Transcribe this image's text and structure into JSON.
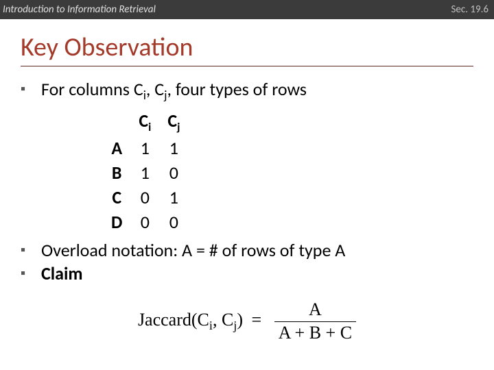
{
  "header": {
    "left": "Introduction to Information Retrieval",
    "right": "Sec. 19.6"
  },
  "title": "Key Observation",
  "bullets": {
    "b1_prefix": "For columns C",
    "b1_mid1": ", C",
    "b1_suffix": ", four types of rows",
    "b2": "Overload notation: A = # of rows of type A",
    "b3_label": "Claim"
  },
  "table": {
    "col_label_base": "C",
    "col_sub_1": "i",
    "col_sub_2": "j",
    "rows": [
      {
        "label": "A",
        "v1": "1",
        "v2": "1"
      },
      {
        "label": "B",
        "v1": "1",
        "v2": "0"
      },
      {
        "label": "C",
        "v1": "0",
        "v2": "1"
      },
      {
        "label": "D",
        "v1": "0",
        "v2": "0"
      }
    ]
  },
  "formula": {
    "fn": "Jaccard",
    "arg1_base": "C",
    "arg1_sub": "i",
    "arg2_base": "C",
    "arg2_sub": "j",
    "eq": "=",
    "num": "A",
    "den": "A + B + C"
  }
}
